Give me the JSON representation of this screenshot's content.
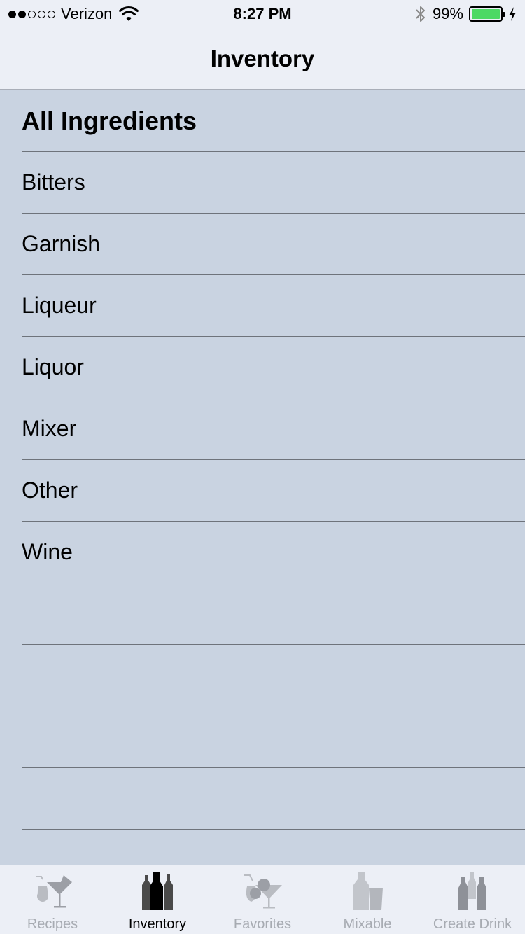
{
  "status_bar": {
    "carrier": "Verizon",
    "signal_bars_filled": 2,
    "signal_bars_total": 5,
    "time": "8:27 PM",
    "battery_percent": "99%",
    "battery_level": 0.99,
    "battery_color": "#4cd964",
    "icons": [
      "wifi-icon",
      "bluetooth-icon",
      "battery-icon",
      "charging-bolt-icon"
    ]
  },
  "nav": {
    "title": "Inventory"
  },
  "list": {
    "items": [
      {
        "label": "All Ingredients",
        "bold": true
      },
      {
        "label": "Bitters"
      },
      {
        "label": "Garnish"
      },
      {
        "label": "Liqueur"
      },
      {
        "label": "Liquor"
      },
      {
        "label": "Mixer"
      },
      {
        "label": "Other"
      },
      {
        "label": "Wine"
      },
      {
        "label": ""
      },
      {
        "label": ""
      },
      {
        "label": ""
      },
      {
        "label": ""
      }
    ]
  },
  "tabs": [
    {
      "label": "Recipes",
      "icon": "cocktail-glasses-icon",
      "active": false
    },
    {
      "label": "Inventory",
      "icon": "bottles-icon",
      "active": true
    },
    {
      "label": "Favorites",
      "icon": "cocktail-fruit-icon",
      "active": false
    },
    {
      "label": "Mixable",
      "icon": "bottle-and-glass-icon",
      "active": false
    },
    {
      "label": "Create Drink",
      "icon": "three-bottles-icon",
      "active": false
    }
  ],
  "colors": {
    "background": "#c9d3e1",
    "bar_background": "#eceff6",
    "tab_inactive": "#a7abb2",
    "tab_active": "#000000"
  }
}
